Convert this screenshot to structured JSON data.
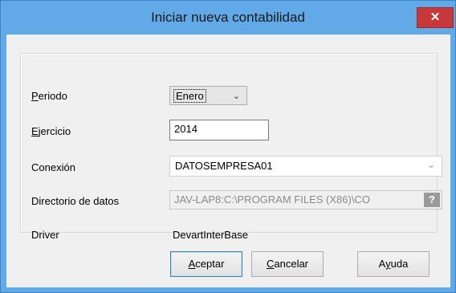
{
  "window": {
    "title": "Iniciar nueva contabilidad",
    "close_glyph": "✕"
  },
  "form": {
    "period": {
      "label": "Periodo",
      "mnemonic": "P",
      "rest": "eriodo",
      "value": "Enero"
    },
    "year": {
      "label": "Ejercicio",
      "mnemonic": "E",
      "rest": "jercicio",
      "value": "2014"
    },
    "connection": {
      "label": "Conexión",
      "value": "DATOSEMPRESA01"
    },
    "data_dir": {
      "label": "Directorio de datos",
      "value": "JAV-LAP8:C:\\PROGRAM FILES (X86)\\CO",
      "help_glyph": "?"
    },
    "driver": {
      "label": "Driver",
      "value": "DevartInterBase"
    }
  },
  "buttons": {
    "accept": {
      "label": "Aceptar",
      "mnemonic": "A",
      "rest": "ceptar"
    },
    "cancel": {
      "label": "Cancelar",
      "mnemonic": "C",
      "rest": "ancelar"
    },
    "help": {
      "label": "Ayuda",
      "pre": "A",
      "mnemonic": "y",
      "rest": "uda"
    }
  },
  "icons": {
    "close": "close-icon",
    "dropdown": "chevron-down-icon",
    "help": "help-icon"
  },
  "colors": {
    "titlebar": "#62a9e8",
    "close_button": "#c7383a",
    "client": "#f0f0f0"
  }
}
